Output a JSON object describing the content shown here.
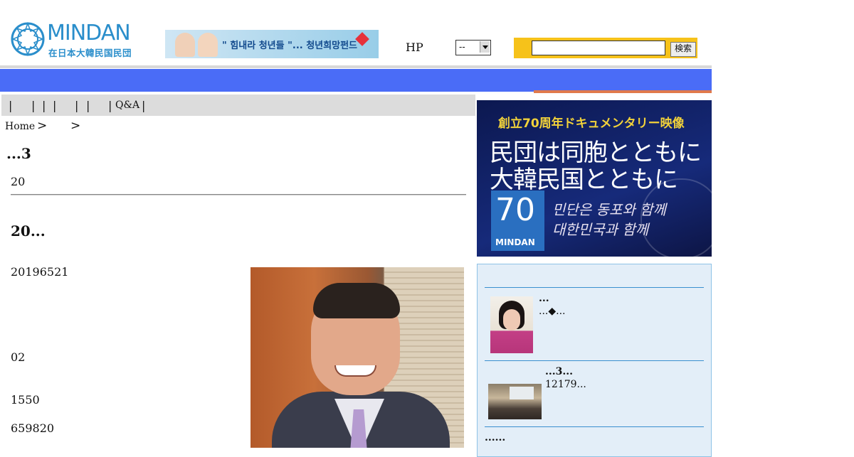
{
  "header": {
    "logo_text": "MINDAN",
    "logo_sub": "在日本大韓民国民団",
    "banner_text": "\" 힘내라 청년들 \"... 청년희망펀드",
    "hp_label": "HP",
    "select_value": "--",
    "search_placeholder": "",
    "search_button": "検索"
  },
  "submenu": {
    "separators": [
      "|",
      "|",
      "|",
      "|",
      "|",
      "|",
      "|",
      "|"
    ],
    "qa": "Q&A"
  },
  "breadcrumb": {
    "home": "Home",
    "sep1": ">",
    "sep2": ">"
  },
  "main": {
    "section_heading": "...3",
    "date_short": "20",
    "article_title": "20...",
    "paragraphs": [
      "20196521",
      "02",
      "1550",
      "659820"
    ]
  },
  "right": {
    "promo": {
      "top": "創立70周年ドキュメンタリー映像",
      "line1": "民団は同胞とともに",
      "line2": "大韓民国とともに",
      "badge_number": "70",
      "badge_text": "MINDAN",
      "kor1": "민단은 동포와 함께",
      "kor2": "대한민국과 함께"
    },
    "items": [
      {
        "title": "...",
        "text": "...◆..."
      },
      {
        "title": "...3...",
        "text": "12179..."
      },
      {
        "title": "......",
        "text": ""
      }
    ]
  },
  "colors": {
    "nav_blue": "#4a6cf7",
    "accent_orange": "#e07a4c",
    "search_yellow": "#f6c21a",
    "logo_blue": "#2a8ecb"
  }
}
